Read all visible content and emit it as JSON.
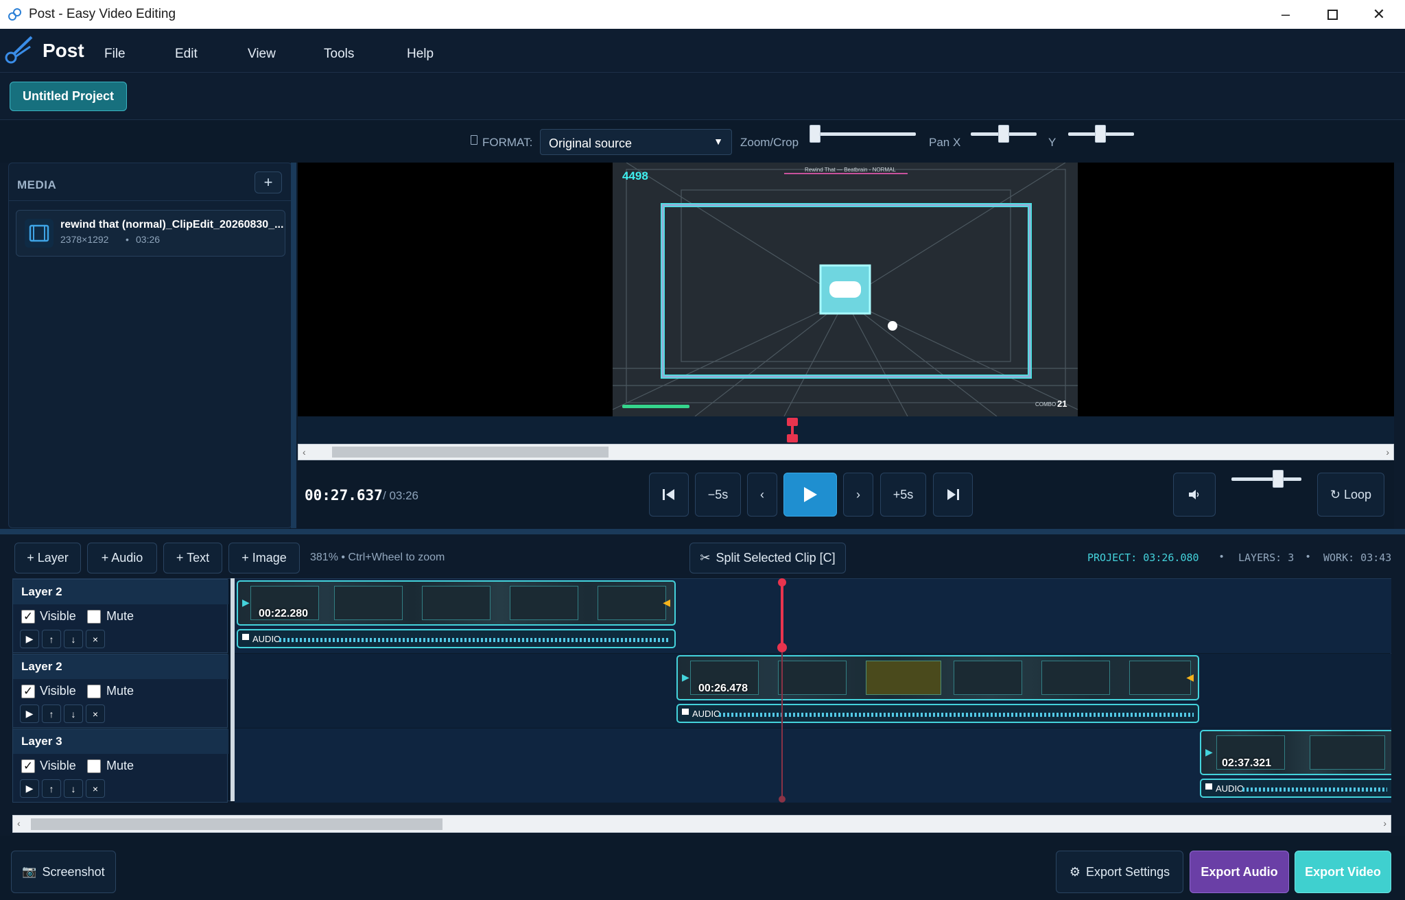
{
  "window": {
    "title": "Post - Easy Video Editing"
  },
  "menubar": {
    "brand": "Post",
    "items": [
      "File",
      "Edit",
      "View",
      "Tools",
      "Help"
    ]
  },
  "project": {
    "name": "Untitled Project"
  },
  "format": {
    "label": "FORMAT:",
    "value": "Original source",
    "zoom_label": "Zoom/Crop",
    "panx_label": "Pan X",
    "y_label": "Y"
  },
  "media": {
    "header": "MEDIA",
    "add": "+",
    "items": [
      {
        "name": "rewind that (normal)_ClipEdit_20260830_...",
        "dims": "2378×1292",
        "sep": "•",
        "duration": "03:26"
      }
    ]
  },
  "preview": {
    "score": "4498",
    "hud_title": "Rewind That — Beatbrain - NORMAL",
    "combo_label": "COMBO",
    "combo_value": "21"
  },
  "transport": {
    "current": "00:27.637",
    "total": "/ 03:26",
    "buttons": {
      "back5": "−5s",
      "prev": "‹",
      "next": "›",
      "fwd5": "+5s",
      "loop": "↻ Loop"
    }
  },
  "timeline": {
    "buttons": {
      "layer": "+ Layer",
      "audio": "+ Audio",
      "text": "+ Text",
      "image": "+ Image",
      "split": "Split Selected Clip [C]"
    },
    "zoom_text": "381% • Ctrl+Wheel to zoom",
    "project_label": "PROJECT: 03:26.080",
    "layers_label": "LAYERS: 3",
    "work_label": "WORK: 03:43",
    "sep": "•",
    "tracks": [
      {
        "name": "Layer 2",
        "visible_label": "Visible",
        "mute_label": "Mute",
        "clip_time": "00:22.280",
        "audio_label": "AUDIO"
      },
      {
        "name": "Layer 2",
        "visible_label": "Visible",
        "mute_label": "Mute",
        "clip_time": "00:26.478",
        "audio_label": "AUDIO"
      },
      {
        "name": "Layer 3",
        "visible_label": "Visible",
        "mute_label": "Mute",
        "clip_time": "02:37.321",
        "audio_label": "AUDIO"
      }
    ],
    "track_controls": [
      "▶",
      "↑",
      "↓",
      "×"
    ],
    "visible_checked": [
      true,
      true,
      true
    ],
    "mute_checked": [
      false,
      false,
      false
    ]
  },
  "footer": {
    "screenshot": "Screenshot",
    "export_settings": "Export Settings",
    "export_audio": "Export Audio",
    "export_video": "Export Video"
  },
  "colors": {
    "accent": "#44d3dc",
    "playhead": "#e8344e",
    "play": "#1f8fd0",
    "export_audio": "#6a3fa6",
    "export_video": "#3fd0cf"
  }
}
